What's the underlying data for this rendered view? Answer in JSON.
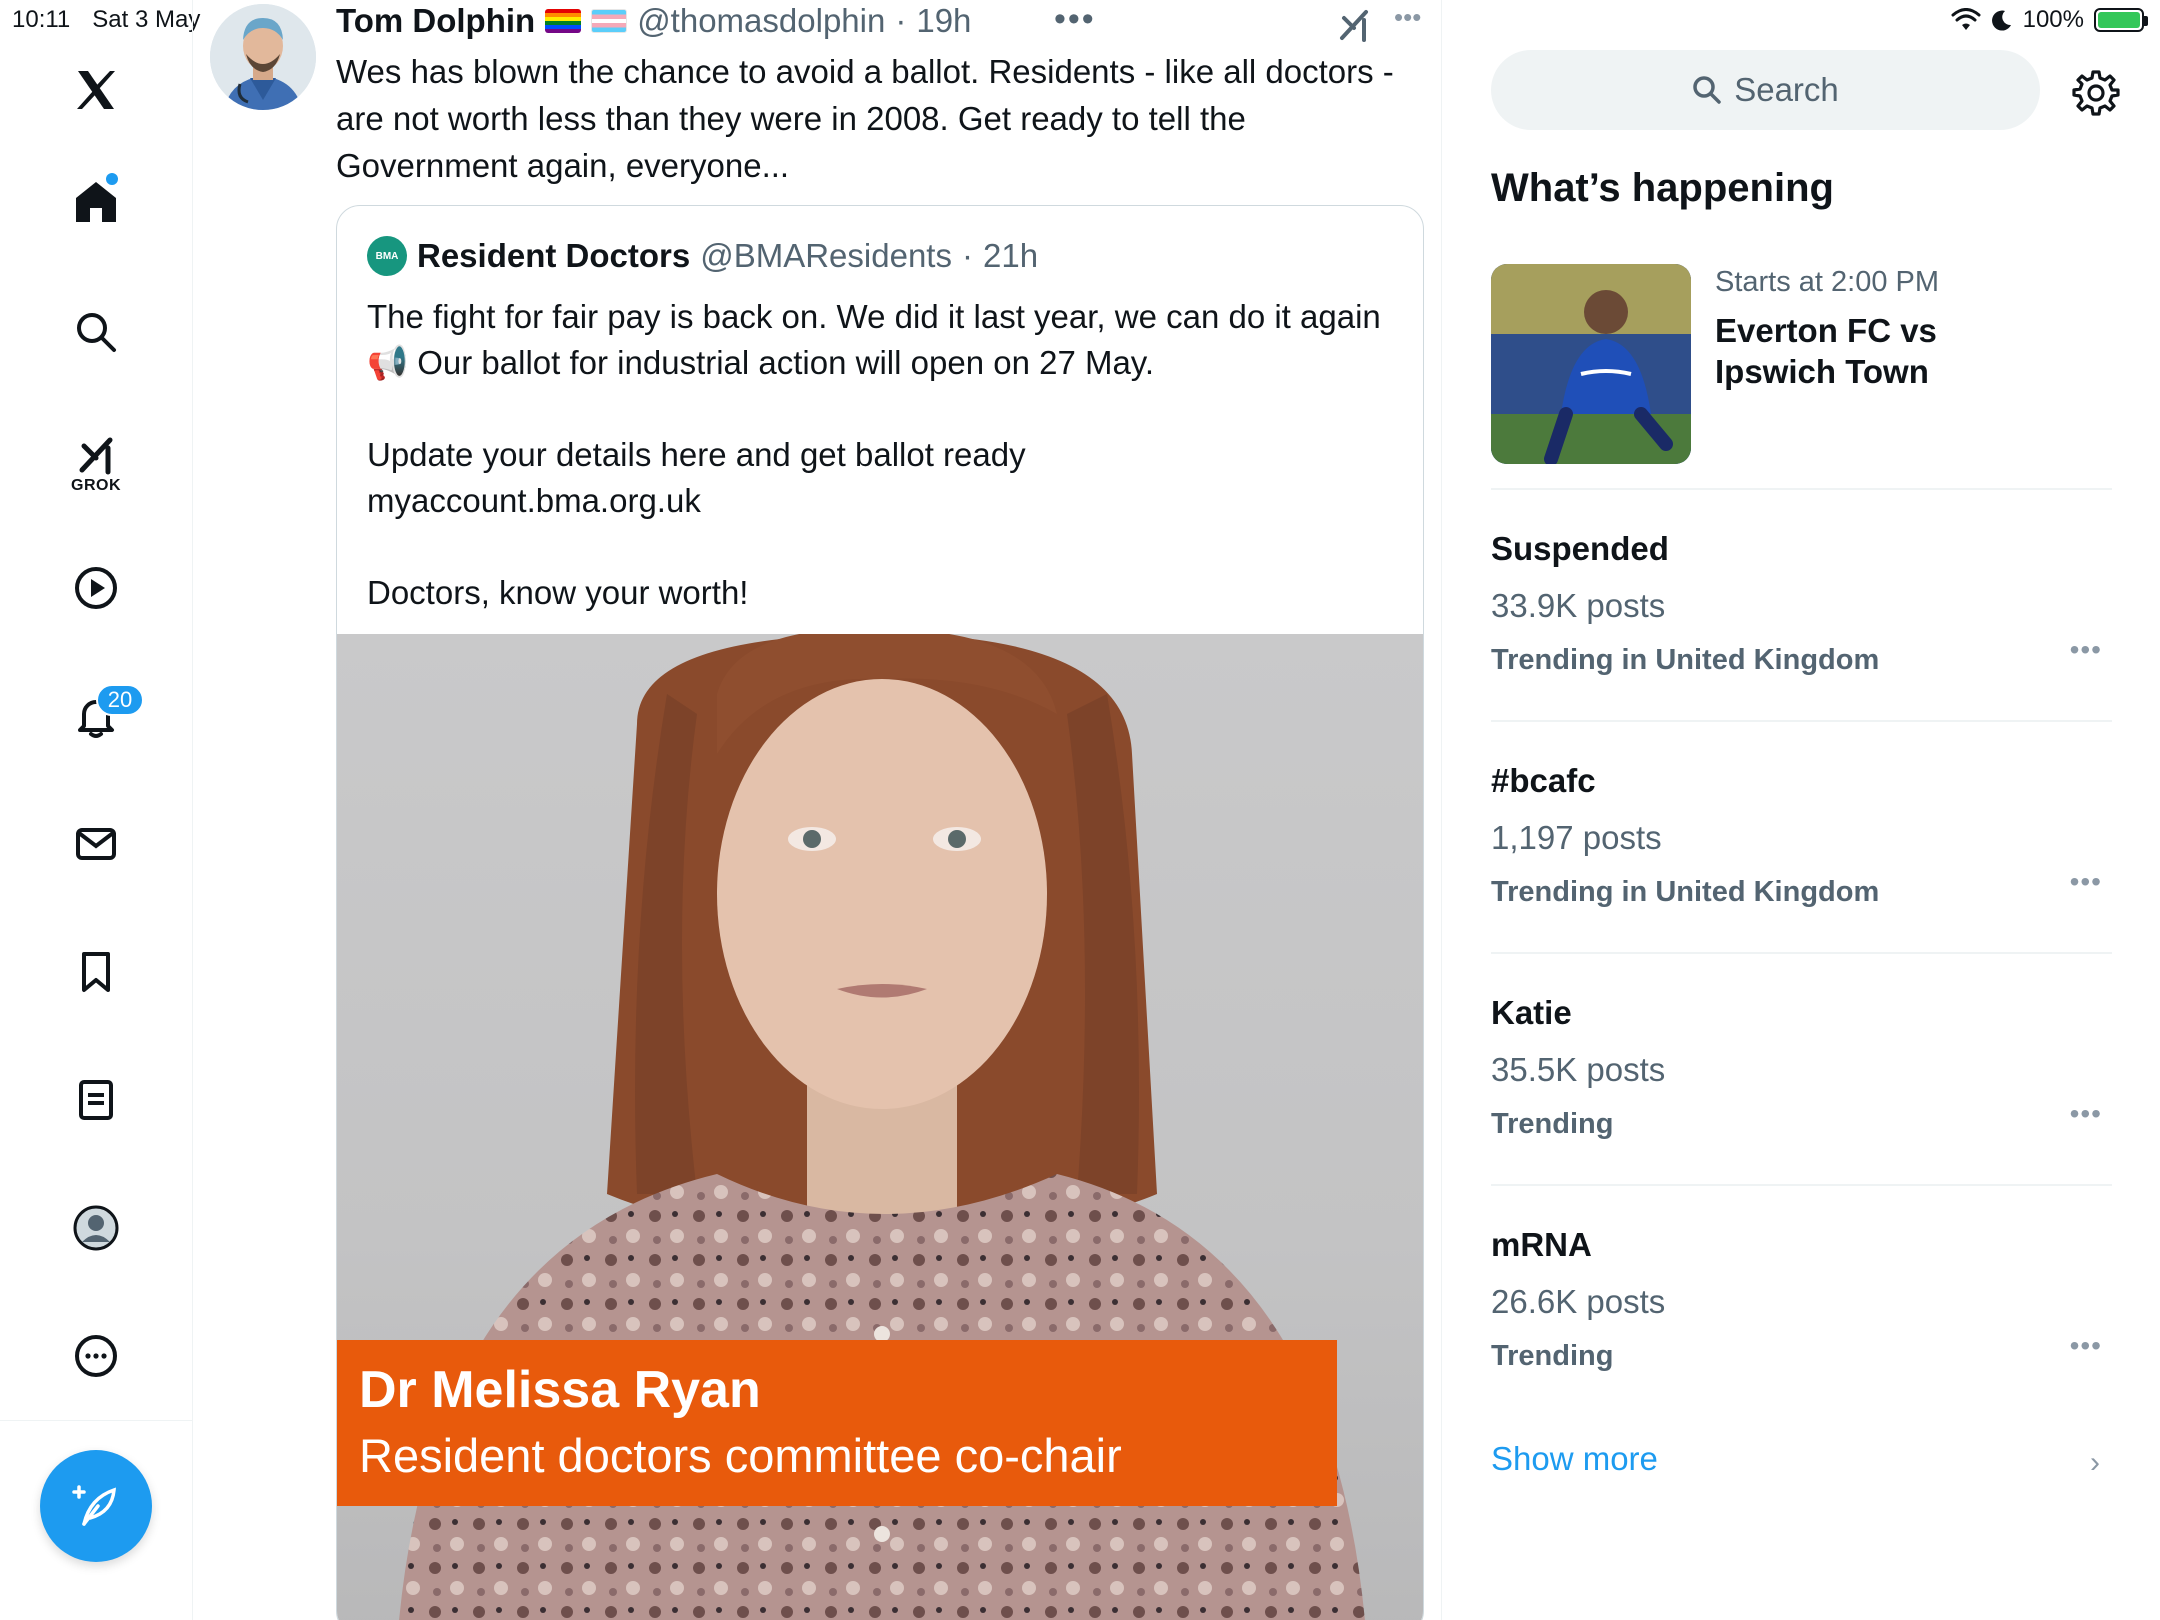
{
  "status_bar": {
    "time": "10:11",
    "date": "Sat 3 May",
    "battery": "100%"
  },
  "nav": {
    "grok_label": "GROK",
    "notifications_badge": "20"
  },
  "tweet": {
    "author_name": "Tom Dolphin",
    "handle": "@thomasdolphin",
    "separator": "·",
    "age": "19h",
    "more": "•••",
    "text": "Wes has blown the chance to avoid a ballot. Residents - like all doctors - are not worth less than they were in 2008. Get ready to tell the Government again, everyone..."
  },
  "quote": {
    "logo_text": "BMA",
    "author_name": "Resident Doctors",
    "handle": "@BMAResidents",
    "separator": "·",
    "age": "21h",
    "para1": "The fight for fair pay is back on. We did it last year, we can do it again 📢 Our ballot for industrial action will open on 27 May.",
    "para2_line1": "Update your details here and get ballot ready",
    "para2_line2": "myaccount.bma.org.uk",
    "para3": "Doctors, know your worth!",
    "video": {
      "lower_third_name": "Dr Melissa Ryan",
      "lower_third_role": "Resident doctors committee co-chair"
    }
  },
  "sidebar": {
    "search_placeholder": "Search",
    "title": "What’s happening",
    "event": {
      "time": "Starts at 2:00 PM",
      "title": "Everton FC vs Ipswich Town"
    },
    "trends": [
      {
        "name": "Suspended",
        "posts": "33.9K posts",
        "context": "Trending in United Kingdom"
      },
      {
        "name": "#bcafc",
        "posts": "1,197 posts",
        "context": "Trending in United Kingdom"
      },
      {
        "name": "Katie",
        "posts": "35.5K posts",
        "context": "Trending"
      },
      {
        "name": "mRNA",
        "posts": "26.6K posts",
        "context": "Trending"
      }
    ],
    "more_dots": "•••",
    "show_more": "Show more",
    "chevron": "›"
  },
  "colors": {
    "accent": "#1d9bf0",
    "muted": "#536471",
    "lower_third": "#e85a0c",
    "bma": "#17967f"
  }
}
